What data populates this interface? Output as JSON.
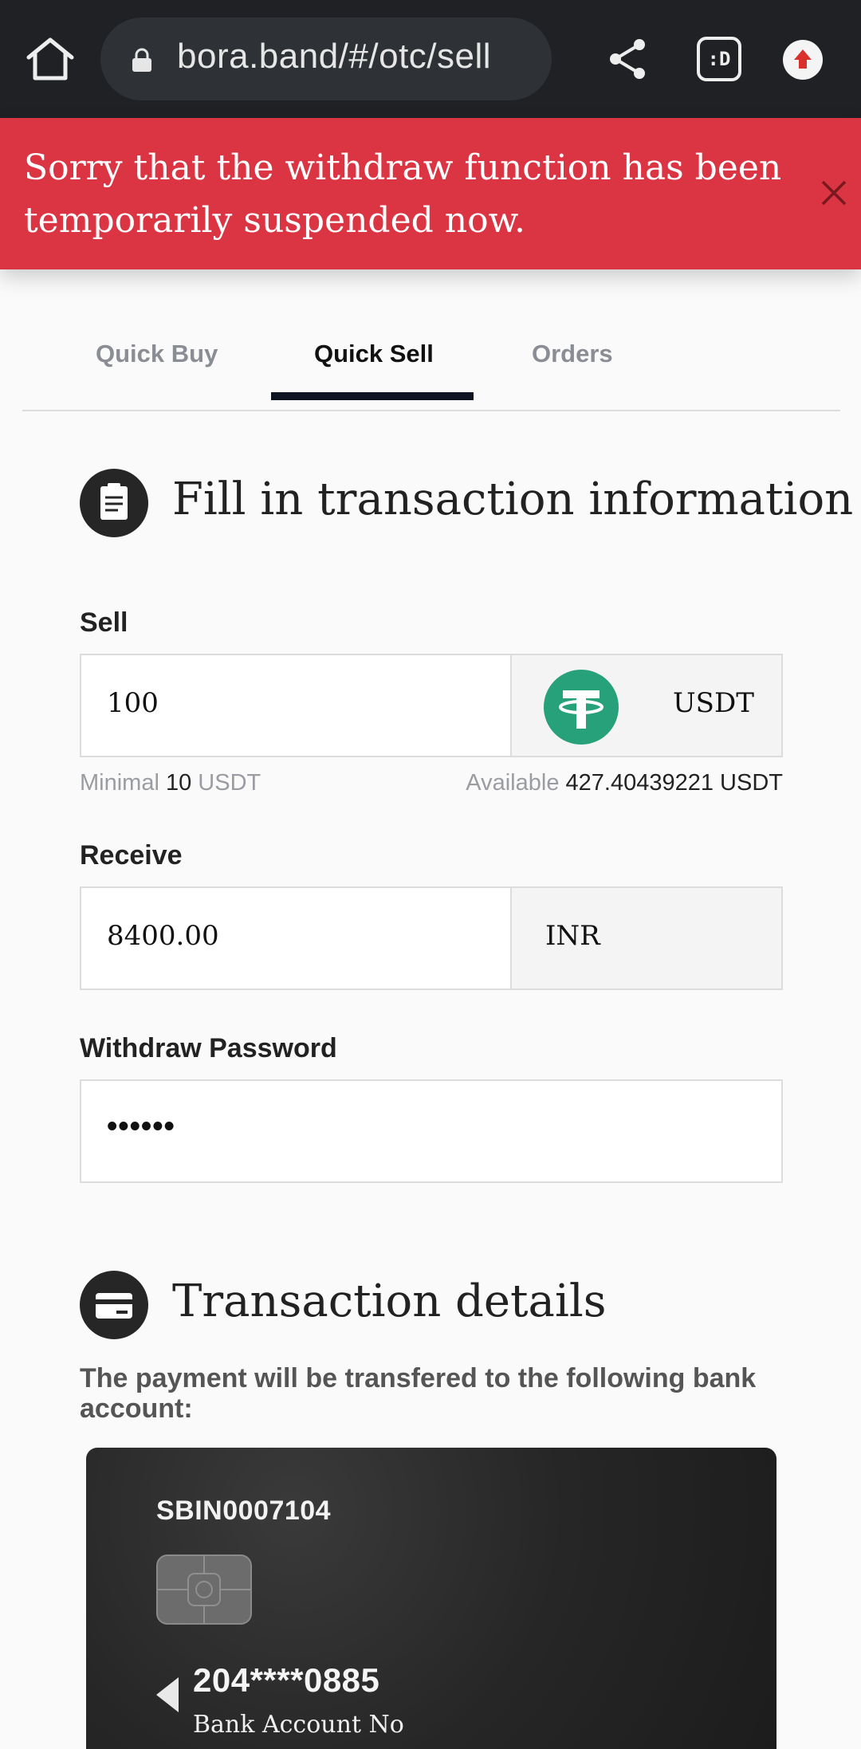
{
  "browser": {
    "url": "bora.band/#/otc/sell",
    "tab_count_label": ":D"
  },
  "alert": {
    "message": "Sorry that the withdraw function has been temporarily suspended now.",
    "background_color": "#db3442"
  },
  "tabs": [
    {
      "label": "Quick Buy",
      "active": false
    },
    {
      "label": "Quick Sell",
      "active": true
    },
    {
      "label": "Orders",
      "active": false
    }
  ],
  "transaction_info": {
    "title": "Fill in transaction information",
    "sell": {
      "label": "Sell",
      "value": "100",
      "currency": "USDT",
      "minimal_label": "Minimal",
      "minimal_value": "10",
      "minimal_unit": "USDT",
      "available_label": "Available",
      "available_value": "427.40439221 USDT"
    },
    "receive": {
      "label": "Receive",
      "value": "8400.00",
      "currency": "INR"
    },
    "password": {
      "label": "Withdraw Password",
      "masked_value": "••••••"
    }
  },
  "transaction_details": {
    "title": "Transaction details",
    "description": "The payment will be transfered to the following bank account:",
    "card": {
      "ifsc": "SBIN0007104",
      "account_number": "204****0885",
      "account_label": "Bank Account No"
    }
  },
  "colors": {
    "tether_green": "#27a17a",
    "active_tab_underline": "#0e1322"
  }
}
